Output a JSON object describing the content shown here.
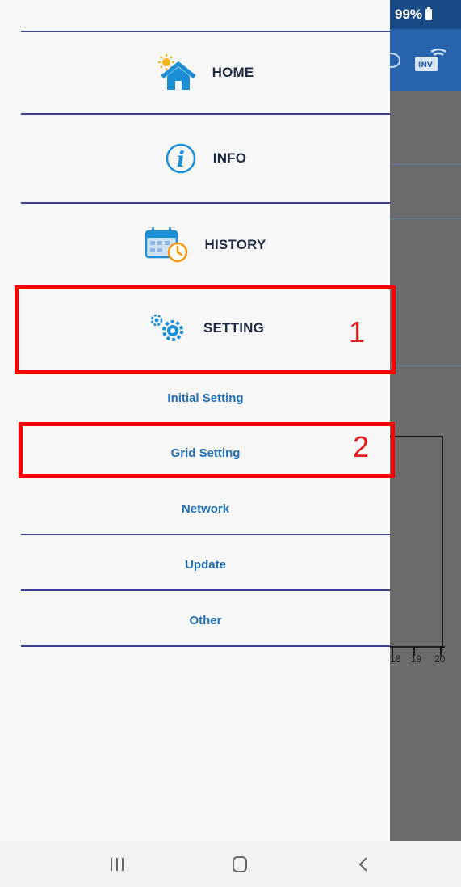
{
  "status_bar": {
    "battery": "99%"
  },
  "drawer": {
    "items": [
      {
        "label": "HOME",
        "icon": "home-icon"
      },
      {
        "label": "INFO",
        "icon": "info-icon"
      },
      {
        "label": "HISTORY",
        "icon": "calendar-clock-icon"
      },
      {
        "label": "SETTING",
        "icon": "gears-icon"
      }
    ],
    "sub_items": [
      {
        "label": "Initial Setting"
      },
      {
        "label": "Grid Setting"
      },
      {
        "label": "Network"
      },
      {
        "label": "Update"
      },
      {
        "label": "Other"
      }
    ]
  },
  "background_chart": {
    "x_ticks": [
      "18",
      "19",
      "20"
    ]
  },
  "annotations": {
    "one": "1",
    "two": "2"
  },
  "colors": {
    "accent": "#1f6fb6",
    "divider": "#3b3f8f",
    "highlight": "#ff0000",
    "appbar": "#2764ad"
  }
}
